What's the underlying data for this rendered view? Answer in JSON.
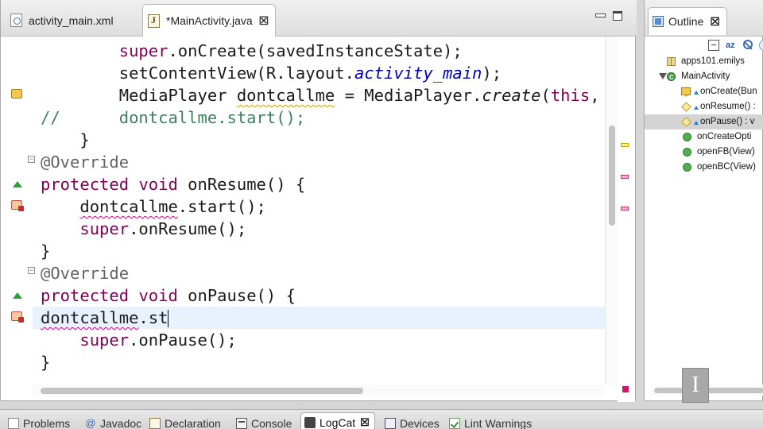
{
  "editor": {
    "tabs": [
      {
        "label": "activity_main.xml",
        "icon": "xml-file-icon"
      },
      {
        "label": "*MainActivity.java",
        "icon": "java-file-icon",
        "close": "☒"
      }
    ],
    "lines": [
      {
        "parts": [
          {
            "t": "        "
          },
          {
            "t": "super",
            "c": "kw"
          },
          {
            "t": ".onCreate(savedInstanceState);"
          }
        ]
      },
      {
        "parts": [
          {
            "t": "        setContentView(R.layout."
          },
          {
            "t": "activity_main",
            "c": "it"
          },
          {
            "t": ");"
          }
        ]
      },
      {
        "parts": [
          {
            "t": "        MediaPlayer "
          },
          {
            "t": "dontcallme",
            "c": "squig-y"
          },
          {
            "t": " = MediaPlayer."
          },
          {
            "t": "create",
            "c": "itc"
          },
          {
            "t": "("
          },
          {
            "t": "this",
            "c": "kw"
          },
          {
            "t": ", R"
          }
        ]
      },
      {
        "parts": [
          {
            "t": "//      dontcallme.start();",
            "c": "cm"
          }
        ]
      },
      {
        "parts": [
          {
            "t": "    }"
          }
        ]
      },
      {
        "parts": [
          {
            "t": "@Override",
            "c": "ann"
          }
        ]
      },
      {
        "parts": [
          {
            "t": "protected",
            "c": "kw"
          },
          {
            "t": " "
          },
          {
            "t": "void",
            "c": "kw"
          },
          {
            "t": " onResume() {"
          }
        ]
      },
      {
        "parts": [
          {
            "t": "    "
          },
          {
            "t": "dontcallme",
            "c": "squig"
          },
          {
            "t": ".start();"
          }
        ]
      },
      {
        "parts": [
          {
            "t": "    "
          },
          {
            "t": "super",
            "c": "kw"
          },
          {
            "t": ".onResume();"
          }
        ]
      },
      {
        "parts": [
          {
            "t": "}"
          }
        ]
      },
      {
        "parts": [
          {
            "t": "@Override",
            "c": "ann"
          }
        ]
      },
      {
        "parts": [
          {
            "t": "protected",
            "c": "kw"
          },
          {
            "t": " "
          },
          {
            "t": "void",
            "c": "kw"
          },
          {
            "t": " onPause() {"
          }
        ]
      },
      {
        "parts": [
          {
            "t": "dontcallme",
            "c": "squig"
          },
          {
            "t": ".st"
          },
          {
            "t": "",
            "c": "caret"
          }
        ]
      },
      {
        "parts": [
          {
            "t": "    "
          },
          {
            "t": "super",
            "c": "kw"
          },
          {
            "t": ".onPause();"
          }
        ]
      },
      {
        "parts": [
          {
            "t": "}"
          }
        ]
      }
    ]
  },
  "outline": {
    "tab_label": "Outline",
    "close": "☒",
    "items": [
      {
        "label": "apps101.emilys",
        "icon": "package-icon"
      },
      {
        "label": "MainActivity",
        "icon": "class-icon",
        "expanded": true
      },
      {
        "label": "onCreate(Bun",
        "icon": "protected-method-icon",
        "warning": true
      },
      {
        "label": "onResume() :",
        "icon": "protected-method-icon"
      },
      {
        "label": "onPause() : v",
        "icon": "protected-method-icon",
        "selected": true
      },
      {
        "label": "onCreateOpti",
        "icon": "public-method-icon"
      },
      {
        "label": "openFB(View)",
        "icon": "public-method-icon"
      },
      {
        "label": "openBC(View)",
        "icon": "public-method-icon"
      }
    ]
  },
  "bottom_tabs": [
    {
      "label": "Problems",
      "icon": "problems-icon"
    },
    {
      "label": "Javadoc",
      "icon": "javadoc-icon"
    },
    {
      "label": "Declaration",
      "icon": "declaration-icon"
    },
    {
      "label": "Console",
      "icon": "console-icon"
    },
    {
      "label": "LogCat",
      "icon": "logcat-icon",
      "active": true,
      "close": "☒"
    },
    {
      "label": "Devices",
      "icon": "devices-icon"
    },
    {
      "label": "Lint Warnings",
      "icon": "lint-icon"
    }
  ],
  "colors": {
    "keyword": "#7f0055",
    "static_italic": "#0000c0",
    "comment": "#3f7f5f",
    "annotation": "#646464",
    "error_squiggle": "#e0008a",
    "current_line": "#e8f2fe"
  }
}
